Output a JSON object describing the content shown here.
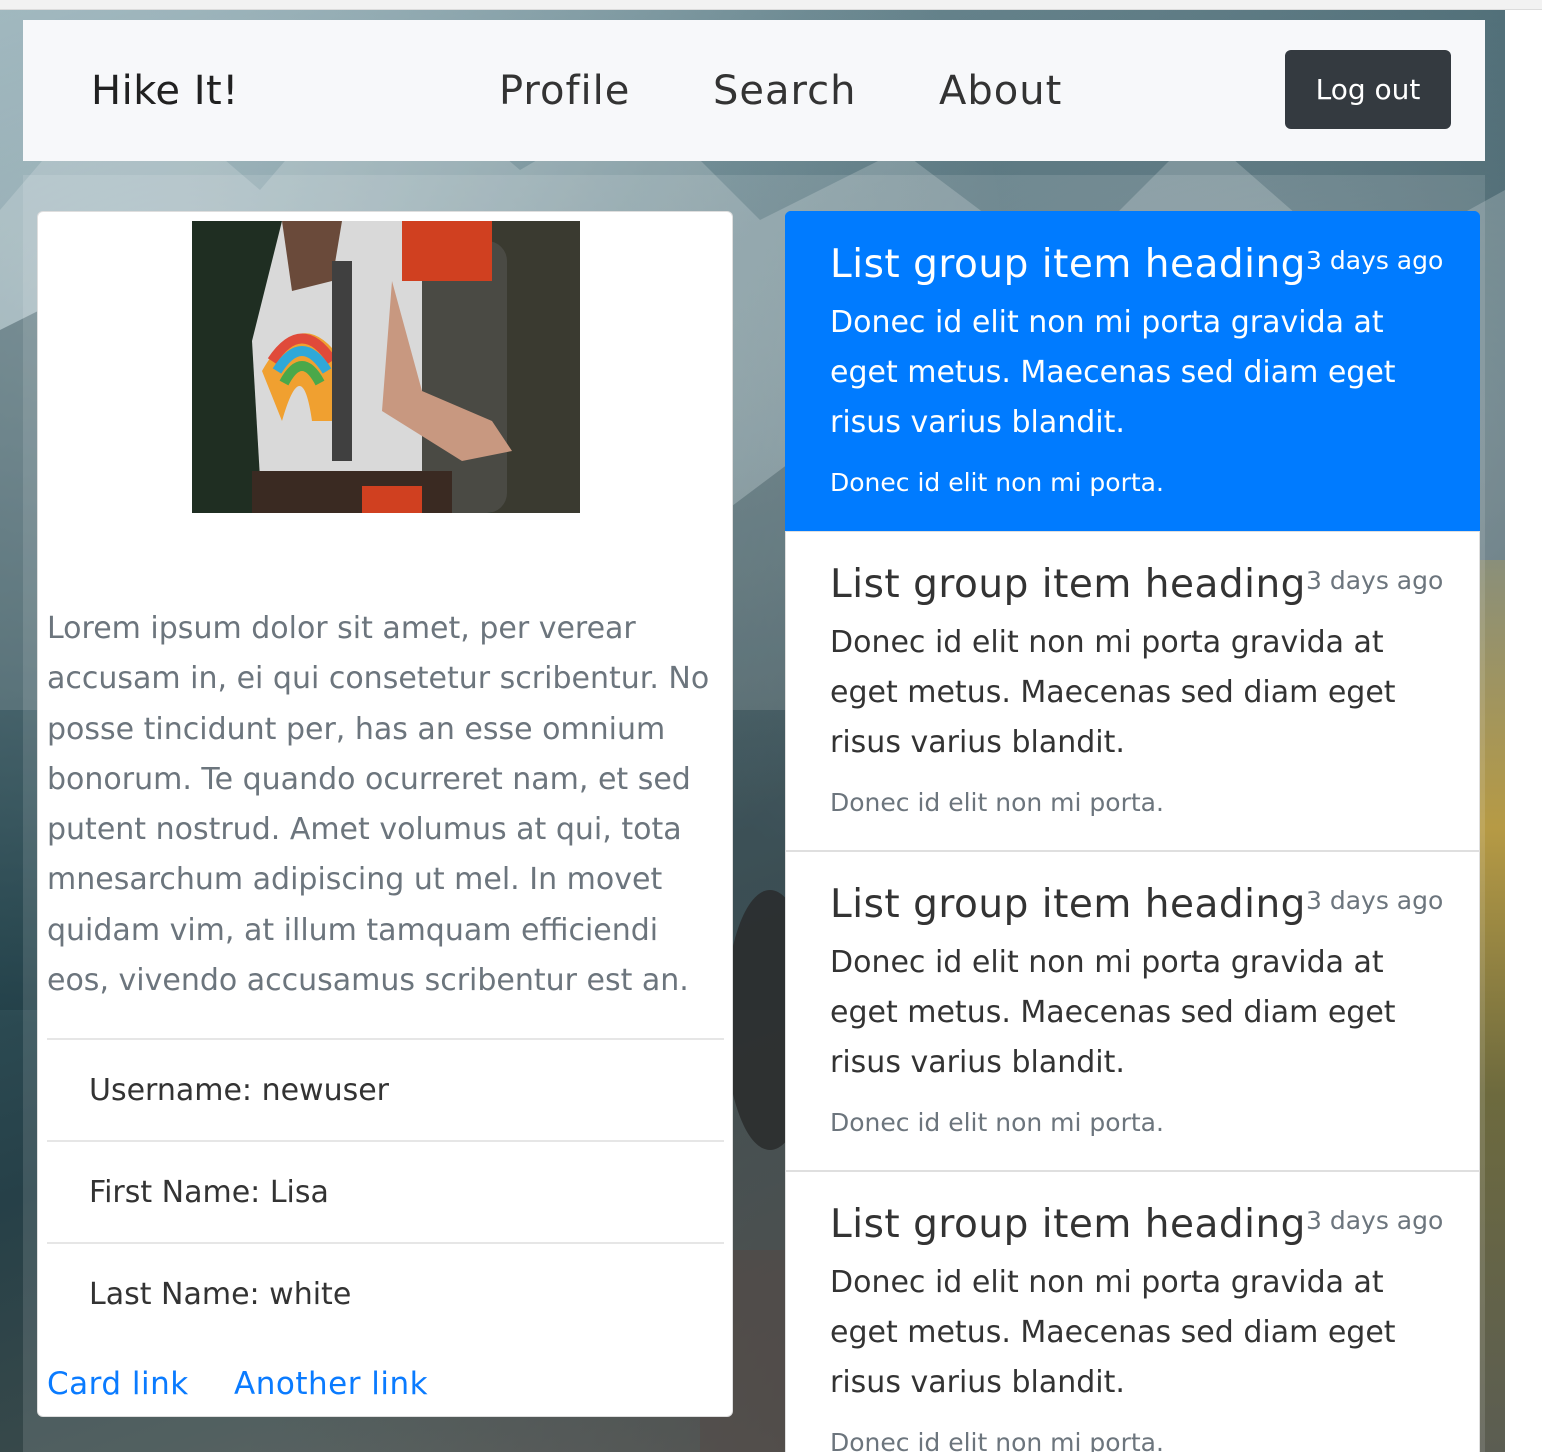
{
  "navbar": {
    "brand": "Hike It!",
    "links": [
      "Profile",
      "Search",
      "About"
    ],
    "logout_label": "Log out"
  },
  "profile_card": {
    "description": "Lorem ipsum dolor sit amet, per verear accusam in, ei qui consetetur scribentur. No posse tincidunt per, has an esse omnium bonorum. Te quando ocurreret nam, et sed putent nostrud. Amet volumus at qui, tota mnesarchum adipiscing ut mel. In movet quidam vim, at illum tamquam efficiendi eos, vivendo accusamus scribentur est an.",
    "rows": [
      "Username: newuser",
      "First Name: Lisa",
      "Last Name: white"
    ],
    "links": [
      "Card link",
      "Another link"
    ]
  },
  "list_group": {
    "items": [
      {
        "heading": "List group item heading",
        "time": "3 days ago",
        "body": "Donec id elit non mi porta gravida at eget metus. Maecenas sed diam eget risus varius blandit.",
        "footer": "Donec id elit non mi porta.",
        "active": true
      },
      {
        "heading": "List group item heading",
        "time": "3 days ago",
        "body": "Donec id elit non mi porta gravida at eget metus. Maecenas sed diam eget risus varius blandit.",
        "footer": "Donec id elit non mi porta.",
        "active": false
      },
      {
        "heading": "List group item heading",
        "time": "3 days ago",
        "body": "Donec id elit non mi porta gravida at eget metus. Maecenas sed diam eget risus varius blandit.",
        "footer": "Donec id elit non mi porta.",
        "active": false
      },
      {
        "heading": "List group item heading",
        "time": "3 days ago",
        "body": "Donec id elit non mi porta gravida at eget metus. Maecenas sed diam eget risus varius blandit.",
        "footer": "Donec id elit non mi porta.",
        "active": false
      }
    ]
  },
  "colors": {
    "active_item": "#007bff",
    "logout_button": "#343a40",
    "link": "#0a7bff"
  }
}
